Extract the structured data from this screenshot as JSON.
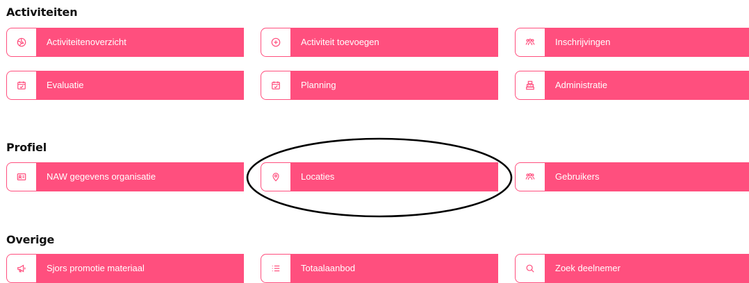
{
  "sections": {
    "activiteiten": {
      "title": "Activiteiten",
      "items": [
        {
          "label": "Activiteitenoverzicht",
          "icon": "volleyball-icon"
        },
        {
          "label": "Activiteit toevoegen",
          "icon": "add-circle-icon"
        },
        {
          "label": "Inschrijvingen",
          "icon": "people-icon"
        },
        {
          "label": "Evaluatie",
          "icon": "calendar-check-icon"
        },
        {
          "label": "Planning",
          "icon": "calendar-check-icon"
        },
        {
          "label": "Administratie",
          "icon": "cash-register-icon"
        }
      ]
    },
    "profiel": {
      "title": "Profiel",
      "items": [
        {
          "label": "NAW gegevens organisatie",
          "icon": "id-card-icon"
        },
        {
          "label": "Locaties",
          "icon": "location-pin-icon"
        },
        {
          "label": "Gebruikers",
          "icon": "people-icon"
        }
      ]
    },
    "overige": {
      "title": "Overige",
      "items": [
        {
          "label": "Sjors promotie materiaal",
          "icon": "megaphone-icon"
        },
        {
          "label": "Totaalaanbod",
          "icon": "list-icon"
        },
        {
          "label": "Zoek deelnemer",
          "icon": "search-icon"
        }
      ]
    }
  },
  "colors": {
    "accent": "#ff4f7e",
    "annotation": "#000000"
  }
}
